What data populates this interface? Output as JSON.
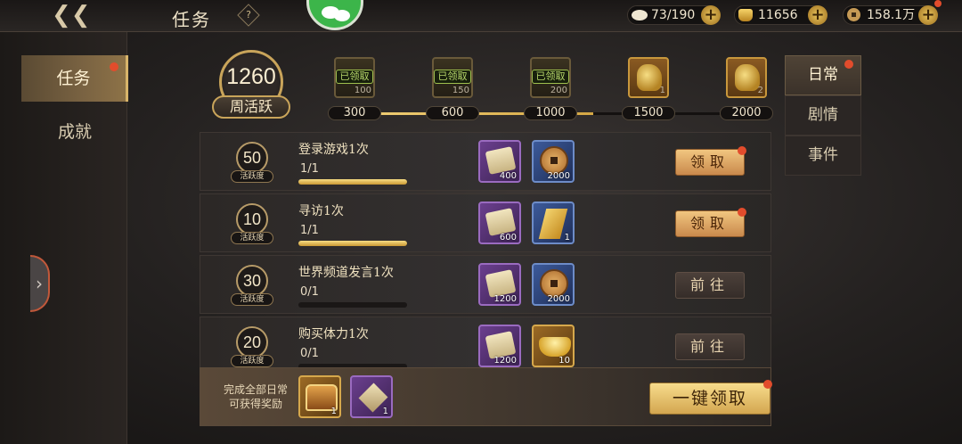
{
  "header": {
    "title": "任务",
    "help": "?",
    "resources": {
      "stamina": "73/190",
      "gold": "11656",
      "coins": "158.1万"
    }
  },
  "sidebar": {
    "items": [
      {
        "label": "任务",
        "active": true,
        "badge": true
      },
      {
        "label": "成就",
        "active": false,
        "badge": false
      }
    ]
  },
  "activity": {
    "value": "1260",
    "label": "周活跃",
    "progress": 0.6,
    "milestones": [
      {
        "threshold": "300",
        "qty": "100",
        "status": "已领取",
        "claimed": true
      },
      {
        "threshold": "600",
        "qty": "150",
        "status": "已领取",
        "claimed": true
      },
      {
        "threshold": "1000",
        "qty": "200",
        "status": "已领取",
        "claimed": true
      },
      {
        "threshold": "1500",
        "qty": "1",
        "status": "",
        "claimed": false
      },
      {
        "threshold": "2000",
        "qty": "2",
        "status": "",
        "claimed": false
      }
    ]
  },
  "right_tabs": [
    {
      "label": "日常",
      "active": true,
      "badge": true
    },
    {
      "label": "剧情",
      "active": false,
      "badge": false
    },
    {
      "label": "事件",
      "active": false,
      "badge": false
    }
  ],
  "points_label": "活跃度",
  "tasks": [
    {
      "points": "50",
      "name": "登录游戏1次",
      "progress": "1/1",
      "fill": 1.0,
      "rewards": [
        {
          "type": "scroll",
          "qty": "400"
        },
        {
          "type": "copper",
          "qty": "2000"
        }
      ],
      "button": "领取",
      "button_type": "claim",
      "badge": true
    },
    {
      "points": "10",
      "name": "寻访1次",
      "progress": "1/1",
      "fill": 1.0,
      "rewards": [
        {
          "type": "scroll",
          "qty": "600"
        },
        {
          "type": "ticket",
          "qty": "1"
        }
      ],
      "button": "领取",
      "button_type": "claim",
      "badge": true
    },
    {
      "points": "30",
      "name": "世界频道发言1次",
      "progress": "0/1",
      "fill": 0.0,
      "rewards": [
        {
          "type": "scroll",
          "qty": "1200"
        },
        {
          "type": "copper",
          "qty": "2000"
        }
      ],
      "button": "前往",
      "button_type": "goto",
      "badge": false
    },
    {
      "points": "20",
      "name": "购买体力1次",
      "progress": "0/1",
      "fill": 0.0,
      "rewards": [
        {
          "type": "scroll",
          "qty": "1200"
        },
        {
          "type": "ingot",
          "qty": "10"
        }
      ],
      "button": "前往",
      "button_type": "goto",
      "badge": false
    }
  ],
  "bottom": {
    "text_line1": "完成全部日常",
    "text_line2": "可获得奖励",
    "rewards": [
      {
        "type": "chest",
        "qty": "1"
      },
      {
        "type": "bag",
        "qty": "1"
      }
    ],
    "claim_all": "一键领取"
  },
  "colors": {
    "accent_gold": "#d4a744",
    "badge_red": "#e24c2c",
    "claimed_green": "#b6d76a"
  }
}
